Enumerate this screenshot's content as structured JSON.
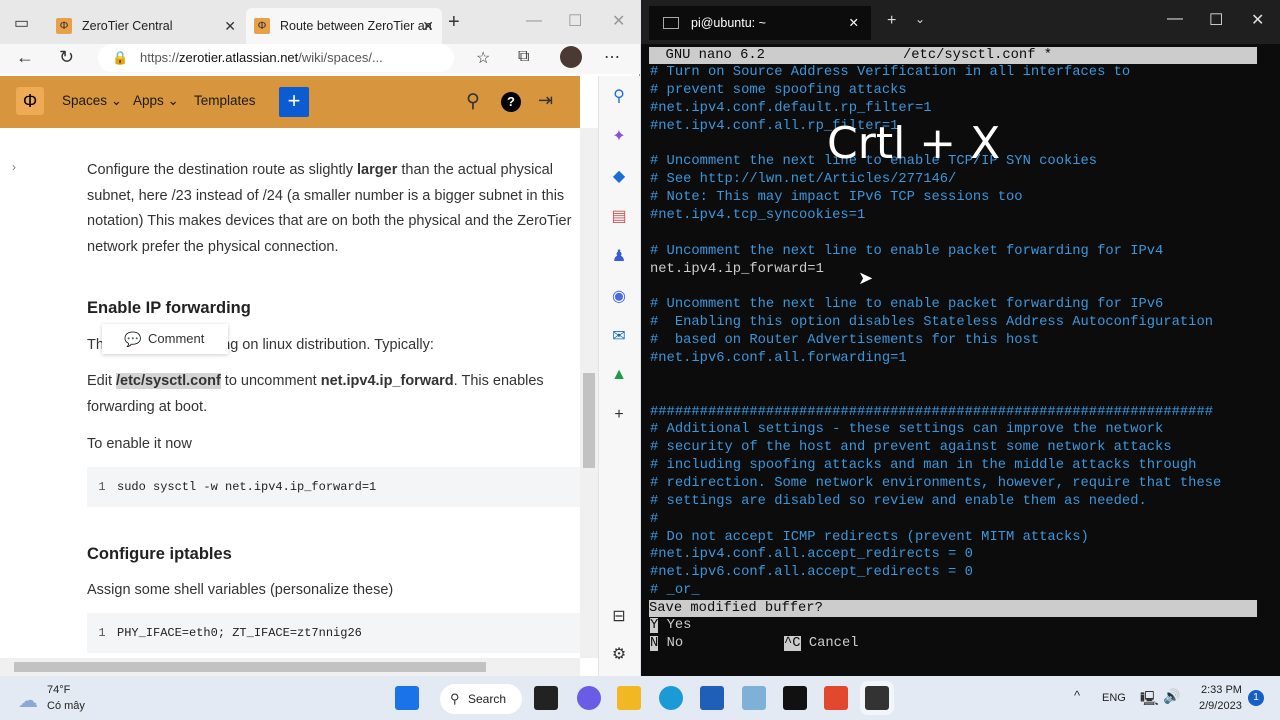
{
  "browser": {
    "tabs": [
      {
        "label": "ZeroTier Central"
      },
      {
        "label": "Route between ZeroTier an"
      }
    ],
    "url_prefix": "https://",
    "url_domain": "zerotier.atlassian.net",
    "url_path": "/wiki/spaces/..."
  },
  "confluence_nav": {
    "spaces": "Spaces",
    "apps": "Apps",
    "templates": "Templates",
    "create": "+"
  },
  "article": {
    "p1_a": "Configure the destination route as slightly ",
    "p1_bold": "larger",
    "p1_b": " than the actual physical subnet, here /23 instead of /24 (a smaller number is a bigger subnet in this notation) This makes devices that are on both the physical and the ZeroTier network prefer the physical connection.",
    "h_ipfwd": "Enable IP forwarding",
    "p2_a": "Th",
    "p2_b": "ing on linux distribution. Typically:",
    "comment": "Comment",
    "p3_a": "Edit ",
    "p3_file": "/etc/sysctl.conf",
    "p3_b": " to uncomment ",
    "p3_key": "net.ipv4.ip_forward",
    "p3_c": ". This enables forwarding at boot.",
    "p4": "To enable it now",
    "code1": {
      "n": "1",
      "text": "sudo sysctl -w net.ipv4.ip_forward=1"
    },
    "h_iptables": "Configure iptables",
    "p5": "Assign some shell variables (personalize these)",
    "code2": {
      "n": "1",
      "text": "PHY_IFACE=eth0; ZT_IFACE=zt7nnig26"
    }
  },
  "terminal": {
    "title": "pi@ubuntu: ~",
    "header_left": "  GNU nano 6.2",
    "header_file": "/etc/sysctl.conf *",
    "lines": [
      "# Turn on Source Address Verification in all interfaces to",
      "# prevent some spoofing attacks",
      "#net.ipv4.conf.default.rp_filter=1",
      "#net.ipv4.conf.all.rp_filter=1",
      "",
      "# Uncomment the next line to enable TCP/IP SYN cookies",
      "# See http://lwn.net/Articles/277146/",
      "# Note: This may impact IPv6 TCP sessions too",
      "#net.ipv4.tcp_syncookies=1",
      "",
      "# Uncomment the next line to enable packet forwarding for IPv4",
      "net.ipv4.ip_forward=1",
      "",
      "# Uncomment the next line to enable packet forwarding for IPv6",
      "#  Enabling this option disables Stateless Address Autoconfiguration",
      "#  based on Router Advertisements for this host",
      "#net.ipv6.conf.all.forwarding=1",
      "",
      "",
      "####################################################################",
      "# Additional settings - these settings can improve the network",
      "# security of the host and prevent against some network attacks",
      "# including spoofing attacks and man in the middle attacks through",
      "# redirection. Some network environments, however, require that these",
      "# settings are disabled so review and enable them as needed.",
      "#",
      "# Do not accept ICMP redirects (prevent MITM attacks)",
      "#net.ipv4.conf.all.accept_redirects = 0",
      "#net.ipv6.conf.all.accept_redirects = 0",
      "# _or_"
    ],
    "prompt": "Save modified buffer?",
    "opt_y_key": "Y",
    "opt_y": "Yes",
    "opt_n_key": "N",
    "opt_n": "No",
    "opt_c_key": "^C",
    "opt_c": "Cancel"
  },
  "overlay": "Crtl + X",
  "taskbar": {
    "temp": "74°F",
    "weather": "Có mây",
    "search": "Search",
    "lang": "ENG",
    "time": "2:33 PM",
    "date": "2/9/2023",
    "badge": "1"
  }
}
